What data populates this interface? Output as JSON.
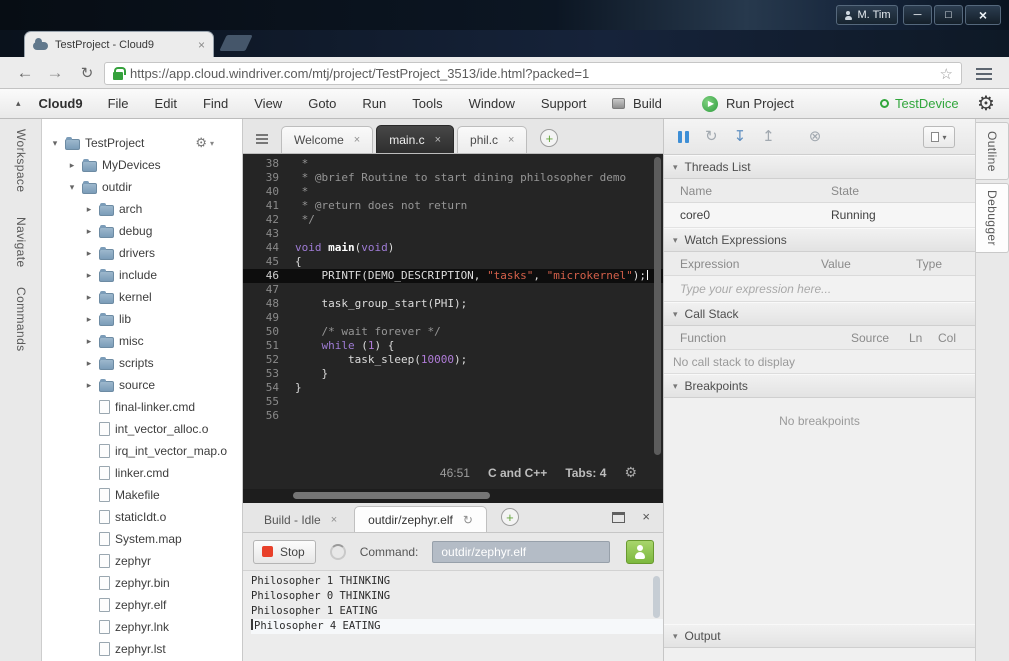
{
  "titlebar": {
    "user_label": "M. Tim"
  },
  "browser": {
    "tab_title": "TestProject - Cloud9",
    "url": "https://app.cloud.windriver.com/mtj/project/TestProject_3513/ide.html?packed=1"
  },
  "menubar": {
    "brand": "Cloud9",
    "items": [
      "File",
      "Edit",
      "Find",
      "View",
      "Goto",
      "Run",
      "Tools",
      "Window",
      "Support"
    ],
    "build_label": "Build",
    "run_label": "Run Project",
    "device_label": "TestDevice"
  },
  "rails": {
    "left": [
      "Workspace",
      "Navigate",
      "Commands"
    ],
    "right": [
      "Outline",
      "Debugger"
    ]
  },
  "tree": {
    "items": [
      {
        "label": "TestProject",
        "type": "folder",
        "level": 0,
        "expanded": true
      },
      {
        "label": "MyDevices",
        "type": "folder",
        "level": 1,
        "expanded": false
      },
      {
        "label": "outdir",
        "type": "folder",
        "level": 1,
        "expanded": true
      },
      {
        "label": "arch",
        "type": "folder",
        "level": 2,
        "expanded": false
      },
      {
        "label": "debug",
        "type": "folder",
        "level": 2,
        "expanded": false
      },
      {
        "label": "drivers",
        "type": "folder",
        "level": 2,
        "expanded": false
      },
      {
        "label": "include",
        "type": "folder",
        "level": 2,
        "expanded": false
      },
      {
        "label": "kernel",
        "type": "folder",
        "level": 2,
        "expanded": false
      },
      {
        "label": "lib",
        "type": "folder",
        "level": 2,
        "expanded": false
      },
      {
        "label": "misc",
        "type": "folder",
        "level": 2,
        "expanded": false
      },
      {
        "label": "scripts",
        "type": "folder",
        "level": 2,
        "expanded": false
      },
      {
        "label": "source",
        "type": "folder",
        "level": 2,
        "expanded": false
      },
      {
        "label": "final-linker.cmd",
        "type": "file",
        "level": 2
      },
      {
        "label": "int_vector_alloc.o",
        "type": "file",
        "level": 2
      },
      {
        "label": "irq_int_vector_map.o",
        "type": "file",
        "level": 2
      },
      {
        "label": "linker.cmd",
        "type": "file",
        "level": 2
      },
      {
        "label": "Makefile",
        "type": "file",
        "level": 2
      },
      {
        "label": "staticIdt.o",
        "type": "file",
        "level": 2
      },
      {
        "label": "System.map",
        "type": "file",
        "level": 2
      },
      {
        "label": "zephyr",
        "type": "file",
        "level": 2
      },
      {
        "label": "zephyr.bin",
        "type": "file",
        "level": 2
      },
      {
        "label": "zephyr.elf",
        "type": "file",
        "level": 2
      },
      {
        "label": "zephyr.lnk",
        "type": "file",
        "level": 2
      },
      {
        "label": "zephyr.lst",
        "type": "file",
        "level": 2
      }
    ]
  },
  "editor": {
    "tabs": [
      {
        "label": "Welcome",
        "active": false
      },
      {
        "label": "main.c",
        "active": true
      },
      {
        "label": "phil.c",
        "active": false
      }
    ],
    "active_line": 46,
    "lines": [
      {
        "no": 38,
        "segs": [
          {
            "c": "comment",
            "t": " *"
          }
        ]
      },
      {
        "no": 39,
        "segs": [
          {
            "c": "comment",
            "t": " * @brief Routine to start dining philosopher demo"
          }
        ]
      },
      {
        "no": 40,
        "segs": [
          {
            "c": "comment",
            "t": " *"
          }
        ]
      },
      {
        "no": 41,
        "segs": [
          {
            "c": "comment",
            "t": " * @return does not return"
          }
        ]
      },
      {
        "no": 42,
        "segs": [
          {
            "c": "comment",
            "t": " */"
          }
        ]
      },
      {
        "no": 43,
        "segs": []
      },
      {
        "no": 44,
        "segs": [
          {
            "c": "kw",
            "t": "void"
          },
          {
            "c": "plain",
            "t": " "
          },
          {
            "c": "fn",
            "t": "main"
          },
          {
            "c": "plain",
            "t": "("
          },
          {
            "c": "kw",
            "t": "void"
          },
          {
            "c": "plain",
            "t": ")"
          }
        ]
      },
      {
        "no": 45,
        "segs": [
          {
            "c": "plain",
            "t": "{"
          }
        ]
      },
      {
        "no": 46,
        "segs": [
          {
            "c": "plain",
            "t": "    PRINTF(DEMO_DESCRIPTION, "
          },
          {
            "c": "str",
            "t": "\"tasks\""
          },
          {
            "c": "plain",
            "t": ", "
          },
          {
            "c": "str",
            "t": "\"microkernel\""
          },
          {
            "c": "plain",
            "t": ");"
          }
        ]
      },
      {
        "no": 47,
        "segs": []
      },
      {
        "no": 48,
        "segs": [
          {
            "c": "plain",
            "t": "    task_group_start(PHI);"
          }
        ]
      },
      {
        "no": 49,
        "segs": []
      },
      {
        "no": 50,
        "segs": [
          {
            "c": "comment",
            "t": "    /* wait forever */"
          }
        ]
      },
      {
        "no": 51,
        "segs": [
          {
            "c": "plain",
            "t": "    "
          },
          {
            "c": "kw",
            "t": "while"
          },
          {
            "c": "plain",
            "t": " ("
          },
          {
            "c": "num",
            "t": "1"
          },
          {
            "c": "plain",
            "t": ") {"
          }
        ]
      },
      {
        "no": 52,
        "segs": [
          {
            "c": "plain",
            "t": "        task_sleep("
          },
          {
            "c": "num",
            "t": "10000"
          },
          {
            "c": "plain",
            "t": ");"
          }
        ]
      },
      {
        "no": 53,
        "segs": [
          {
            "c": "plain",
            "t": "    }"
          }
        ]
      },
      {
        "no": 54,
        "segs": [
          {
            "c": "plain",
            "t": "}"
          }
        ]
      },
      {
        "no": 55,
        "segs": []
      },
      {
        "no": 56,
        "segs": []
      }
    ],
    "status": {
      "position": "46:51",
      "syntax": "C and C++",
      "tab_info": "Tabs: 4"
    }
  },
  "console": {
    "tabs": [
      {
        "label": "Build - Idle",
        "active": false
      },
      {
        "label": "outdir/zephyr.elf",
        "active": true
      }
    ],
    "stop_label": "Stop",
    "command_label": "Command:",
    "command_value": "outdir/zephyr.elf",
    "output": [
      "Philosopher 1 THINKING",
      "Philosopher 0 THINKING",
      "Philosopher 1 EATING",
      "Philosopher 4 EATING"
    ]
  },
  "debugger": {
    "threads": {
      "title": "Threads List",
      "columns": [
        "Name",
        "State"
      ],
      "rows": [
        [
          "core0",
          "Running"
        ]
      ]
    },
    "watch": {
      "title": "Watch Expressions",
      "columns": [
        "Expression",
        "Value",
        "Type"
      ],
      "placeholder": "Type your expression here..."
    },
    "callstack": {
      "title": "Call Stack",
      "columns": [
        "Function",
        "Source",
        "Ln",
        "Col"
      ],
      "empty": "No call stack to display"
    },
    "breakpoints": {
      "title": "Breakpoints",
      "empty": "No breakpoints"
    },
    "output": {
      "title": "Output"
    }
  },
  "icons": {
    "minimize": "─",
    "maximize": "□",
    "close": "×",
    "tab_close": "×",
    "back": "←",
    "forward": "→",
    "reload": "↻",
    "star": "☆",
    "collapse_up": "▴",
    "caret_down": "▾",
    "expanded": "▾",
    "collapsed": "▸",
    "gear": "⚙",
    "play": "▶",
    "plus": "+",
    "spinner": "↻",
    "step_into": "↧",
    "step_out": "↥",
    "stop_circle": "⊗"
  },
  "colors": {
    "accent_green": "#31a63c",
    "stop_red": "#e8402a",
    "pause_blue": "#3e8fd6"
  }
}
